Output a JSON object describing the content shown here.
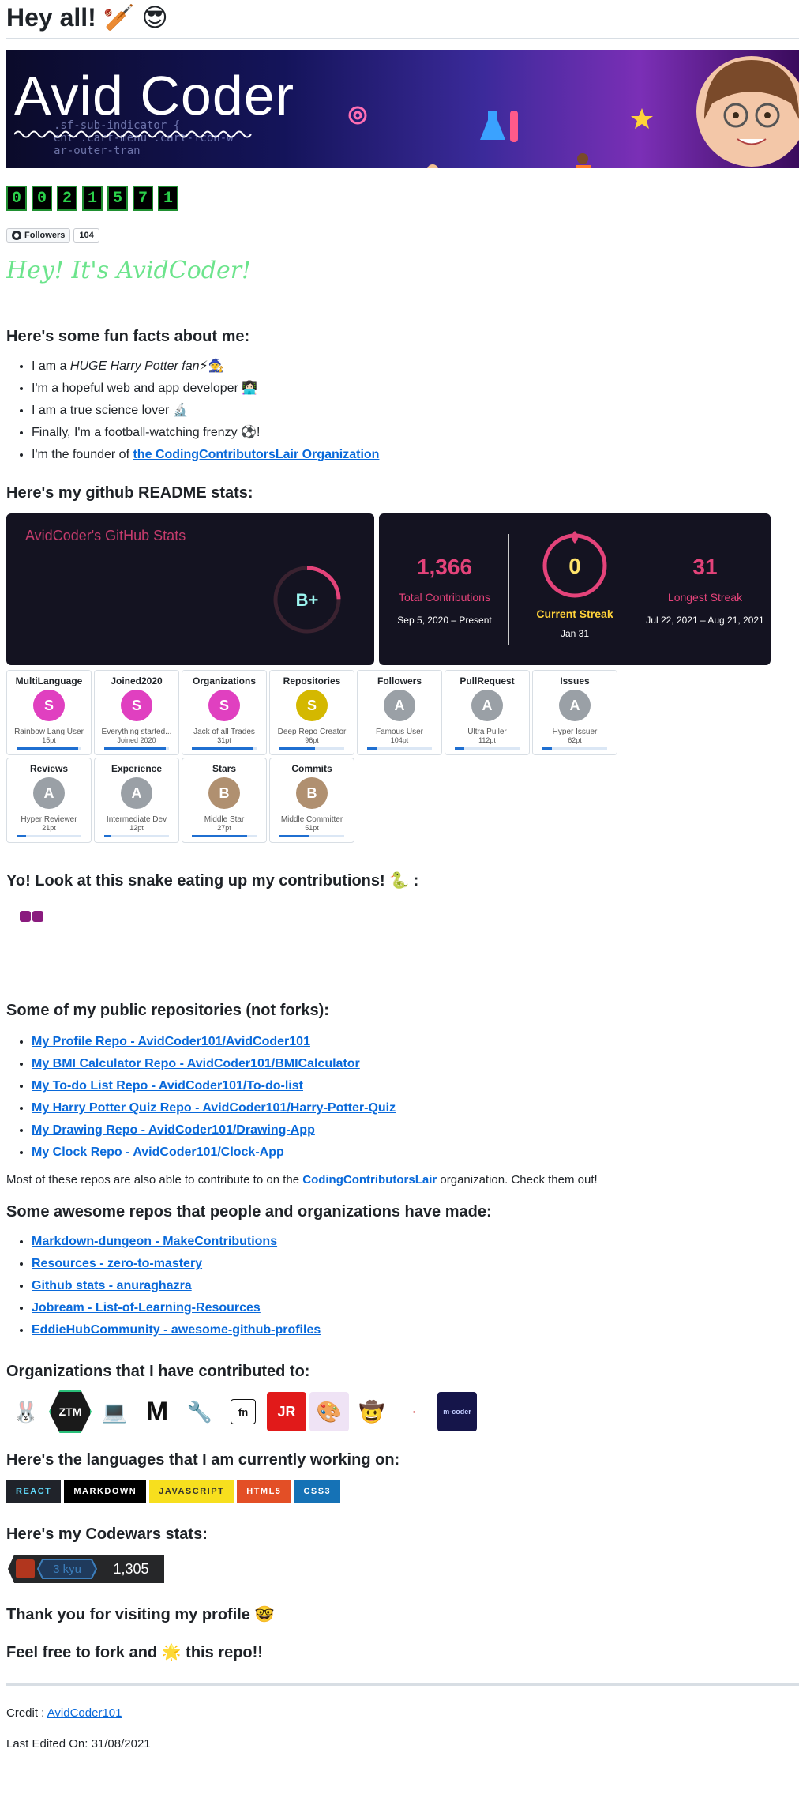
{
  "header": {
    "title": "Hey all! 🏏 😎"
  },
  "banner": {
    "title": "Avid Coder",
    "code_lines": [
      ".sf-sub-indicator {",
      "ent .cart-menu .cart-icon-w",
      "ar-outer-tran"
    ]
  },
  "counter": {
    "digits": [
      "0",
      "0",
      "2",
      "1",
      "5",
      "7",
      "1"
    ]
  },
  "followers": {
    "label": "Followers",
    "count": "104"
  },
  "greeting": "Hey! It's AvidCoder!",
  "fun_facts": {
    "heading": "Here's some fun facts about me:",
    "items": [
      "I am a HUGE Harry Potter fan⚡🧙‍♂️",
      "I'm a hopeful web and app developer 👩🏻‍💻",
      "I am a true science lover 🔬",
      "Finally, I'm a football-watching frenzy ⚽!",
      "I'm the founder of "
    ],
    "item0_pre": "I am a ",
    "item0_em": "HUGE Harry Potter fan",
    "item0_post": "⚡🧙",
    "founder_link": "the CodingContributorsLair Organization"
  },
  "stats_heading": "Here's my github README stats:",
  "github_stats": {
    "title": "AvidCoder's GitHub Stats",
    "grade": "B+",
    "grade_color": "#e4437a"
  },
  "streak": {
    "total": "1,366",
    "total_label": "Total Contributions",
    "total_range": "Sep 5, 2020 – Present",
    "current": "0",
    "current_label": "Current Streak",
    "current_date": "Jan 31",
    "longest": "31",
    "longest_label": "Longest Streak",
    "longest_range": "Jul 22, 2021 – Aug 21, 2021"
  },
  "trophies": [
    {
      "title": "MultiLanguage",
      "rank": "S",
      "name": "Rainbow Lang User",
      "pt": "15pt",
      "fill": 0.95,
      "color": "#e040c0"
    },
    {
      "title": "Joined2020",
      "rank": "S",
      "name": "Everything started...",
      "sub": "Joined 2020",
      "pt": "",
      "fill": 0.95,
      "color": "#e040c0"
    },
    {
      "title": "Organizations",
      "rank": "S",
      "name": "Jack of all Trades",
      "pt": "31pt",
      "fill": 0.95,
      "color": "#e040c0"
    },
    {
      "title": "Repositories",
      "rank": "S",
      "name": "Deep Repo Creator",
      "pt": "96pt",
      "fill": 0.55,
      "color": "#d4b800"
    },
    {
      "title": "Followers",
      "rank": "A",
      "name": "Famous User",
      "pt": "104pt",
      "fill": 0.15,
      "color": "#9aa0a6"
    },
    {
      "title": "PullRequest",
      "rank": "A",
      "name": "Ultra Puller",
      "pt": "112pt",
      "fill": 0.15,
      "color": "#9aa0a6"
    },
    {
      "title": "Issues",
      "rank": "A",
      "name": "Hyper Issuer",
      "pt": "62pt",
      "fill": 0.15,
      "color": "#9aa0a6"
    },
    {
      "title": "Reviews",
      "rank": "A",
      "name": "Hyper Reviewer",
      "pt": "21pt",
      "fill": 0.15,
      "color": "#9aa0a6"
    },
    {
      "title": "Experience",
      "rank": "A",
      "name": "Intermediate Dev",
      "pt": "12pt",
      "fill": 0.1,
      "color": "#9aa0a6"
    },
    {
      "title": "Stars",
      "rank": "B",
      "name": "Middle Star",
      "pt": "27pt",
      "fill": 0.85,
      "color": "#b09070"
    },
    {
      "title": "Commits",
      "rank": "B",
      "name": "Middle Committer",
      "pt": "51pt",
      "fill": 0.45,
      "color": "#b09070"
    }
  ],
  "snake_heading": "Yo! Look at this snake eating up my contributions! 🐍 :",
  "repos": {
    "heading": "Some of my public repositories (not forks):",
    "links": [
      "My Profile Repo - AvidCoder101/AvidCoder101",
      "My BMI Calculator Repo - AvidCoder101/BMICalculator",
      "My To-do List Repo - AvidCoder101/To-do-list",
      "My Harry Potter Quiz Repo - AvidCoder101/Harry-Potter-Quiz",
      "My Drawing Repo - AvidCoder101/Drawing-App",
      "My Clock Repo - AvidCoder101/Clock-App"
    ],
    "note_pre": "Most of these repos are also able to contribute to on the ",
    "note_link": "CodingContributorsLair",
    "note_post": " organization. Check them out!"
  },
  "awesome": {
    "heading": "Some awesome repos that people and organizations have made:",
    "links": [
      "Markdown-dungeon - MakeContributions",
      "Resources - zero-to-mastery",
      "Github stats - anuraghazra",
      "Jobream - List-of-Learning-Resources",
      "EddieHubCommunity - awesome-github-profiles"
    ]
  },
  "orgs": {
    "heading": "Organizations that I have contributed to:",
    "logos": [
      "🐰",
      "ZTM",
      "💻",
      "M",
      "🔧",
      "fn",
      "JR",
      "🎨",
      "🤠",
      "·",
      "m-coder"
    ]
  },
  "languages": {
    "heading": "Here's the languages that I am currently working on:",
    "badges": [
      {
        "label": "REACT",
        "bg": "#20232a",
        "fg": "#61dafb"
      },
      {
        "label": "MARKDOWN",
        "bg": "#000000",
        "fg": "#ffffff"
      },
      {
        "label": "JAVASCRIPT",
        "bg": "#f7df1e",
        "fg": "#323330"
      },
      {
        "label": "HTML5",
        "bg": "#e34f26",
        "fg": "#ffffff"
      },
      {
        "label": "CSS3",
        "bg": "#1572b6",
        "fg": "#ffffff"
      }
    ]
  },
  "codewars": {
    "heading": "Here's my Codewars stats:",
    "rank": "3 kyu",
    "honor": "1,305"
  },
  "thanks": "Thank you for visiting my profile 🤓",
  "fork": "Feel free to fork and 🌟 this repo!!",
  "credit": {
    "label": "Credit : ",
    "link": "AvidCoder101"
  },
  "last_edited": "Last Edited On: 31/08/2021"
}
